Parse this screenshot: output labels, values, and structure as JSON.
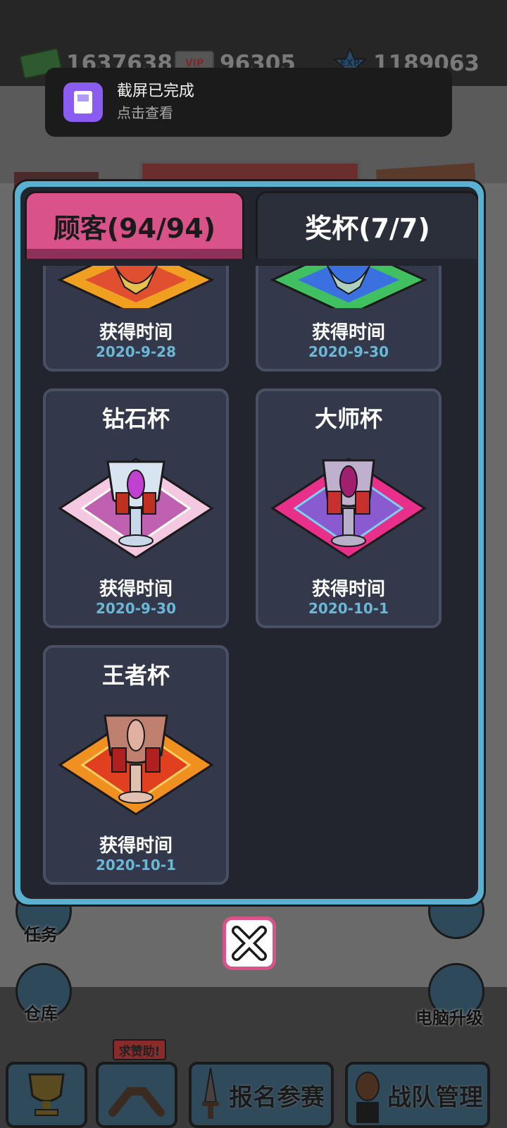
{
  "top_stats": {
    "cash": "1637638",
    "vip": "96305",
    "exp": "1189063",
    "vip_icon_text": "VIP",
    "exp_icon_text": "EXP"
  },
  "notification": {
    "title": "截屏已完成",
    "subtitle": "点击查看"
  },
  "tabs": {
    "customers": "顾客(94/94)",
    "trophies": "奖杯(7/7)"
  },
  "trophy_cards": [
    {
      "title": "",
      "label": "获得时间",
      "date": "2020-9-28",
      "theme": "gold"
    },
    {
      "title": "",
      "label": "获得时间",
      "date": "2020-9-30",
      "theme": "rainbow"
    },
    {
      "title": "钻石杯",
      "label": "获得时间",
      "date": "2020-9-30",
      "theme": "diamond"
    },
    {
      "title": "大师杯",
      "label": "获得时间",
      "date": "2020-10-1",
      "theme": "master"
    },
    {
      "title": "王者杯",
      "label": "获得时间",
      "date": "2020-10-1",
      "theme": "king"
    }
  ],
  "side_buttons": {
    "tasks": "任务",
    "warehouse": "仓库",
    "computer_upgrade": "电脑升级"
  },
  "bottom_nav": {
    "help_badge": "求赞助!",
    "register": "报名参赛",
    "team": "战队管理"
  },
  "colors": {
    "panel_border": "#5ab0d0",
    "tab_active": "#d9528a",
    "date_text": "#68b8d8"
  }
}
